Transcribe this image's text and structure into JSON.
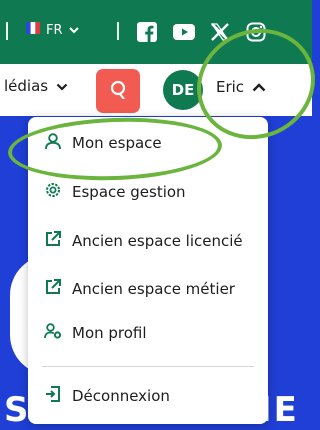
{
  "topbar": {
    "language": "FR",
    "icons": [
      "flag-icon",
      "chevron-down-icon",
      "facebook-icon",
      "youtube-icon",
      "x-icon",
      "instagram-icon"
    ]
  },
  "nav": {
    "medias_label": "lédias",
    "avatar_initials": "DE",
    "user_name": "Eric"
  },
  "menu": {
    "items": [
      {
        "label": "Mon espace",
        "icon": "user-icon"
      },
      {
        "label": "Espace gestion",
        "icon": "gear-icon"
      },
      {
        "label": "Ancien espace licencié",
        "icon": "external-link-icon"
      },
      {
        "label": "Ancien espace métier",
        "icon": "external-link-icon"
      },
      {
        "label": "Mon profil",
        "icon": "user-settings-icon"
      }
    ],
    "logout_label": "Déconnexion",
    "logout_icon": "logout-icon"
  },
  "colors": {
    "brand_green": "#0f7a52",
    "accent_red": "#f25b52",
    "hero_blue": "#1f3fd6",
    "highlight_ring": "#6bb43d"
  }
}
